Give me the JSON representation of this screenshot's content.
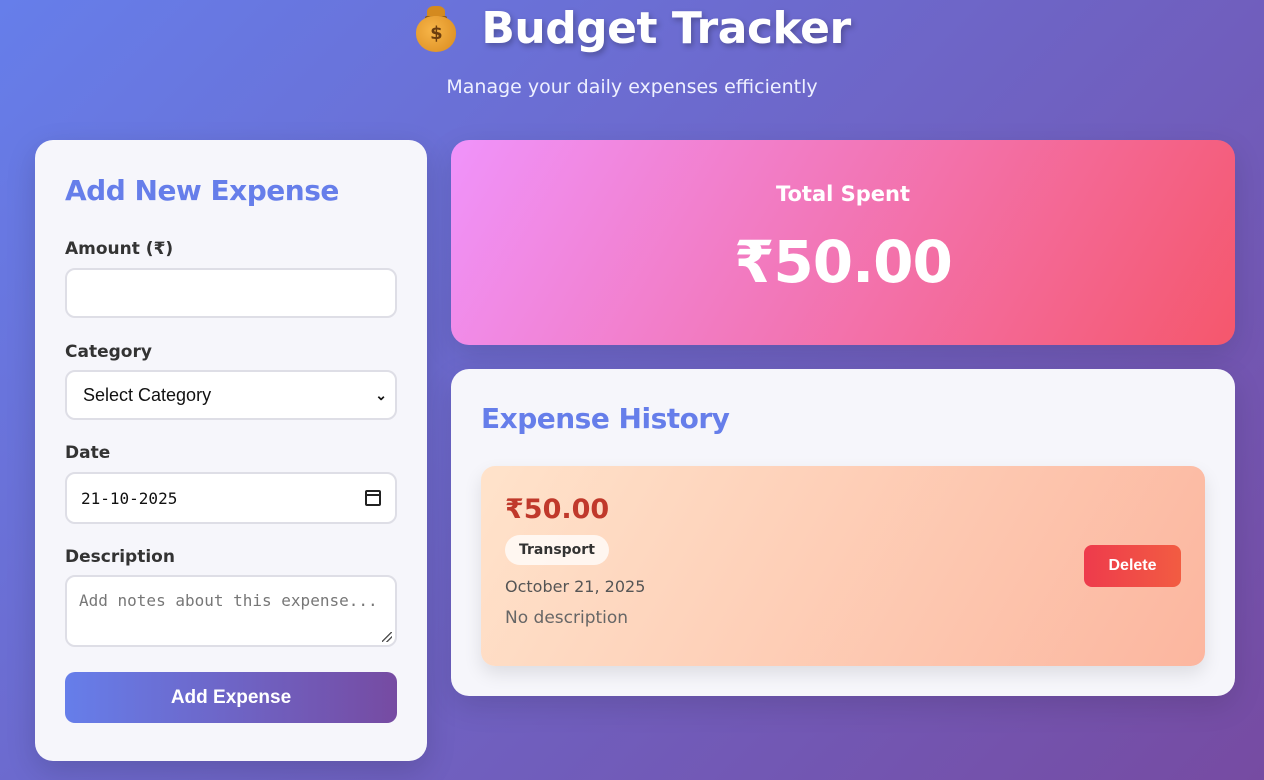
{
  "header": {
    "icon": "money-bag-icon",
    "icon_glyph": "$",
    "title": "Budget Tracker",
    "subtitle": "Manage your daily expenses efficiently"
  },
  "form": {
    "heading": "Add New Expense",
    "amount_label": "Amount (₹)",
    "amount_value": "",
    "category_label": "Category",
    "category_selected": "Select Category",
    "date_label": "Date",
    "date_value": "21-10-2025",
    "description_label": "Description",
    "description_placeholder": "Add notes about this expense...",
    "submit_label": "Add Expense"
  },
  "summary": {
    "label": "Total Spent",
    "amount": "₹50.00"
  },
  "history": {
    "heading": "Expense History",
    "items": [
      {
        "amount": "₹50.00",
        "category": "Transport",
        "date": "October 21, 2025",
        "description": "No description",
        "delete_label": "Delete"
      }
    ]
  },
  "colors": {
    "background_start": "#667eea",
    "background_end": "#764ba2",
    "accent": "#667eea",
    "total_gradient_start": "#f093fb",
    "total_gradient_end": "#f5576c",
    "expense_amount": "#c0392b",
    "delete_button": "#ee3b4c"
  }
}
